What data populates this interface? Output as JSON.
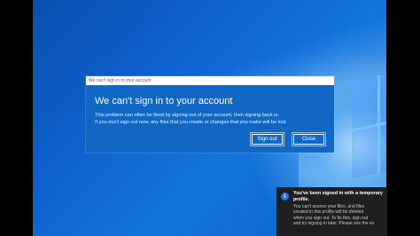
{
  "dialog": {
    "titlebar": "We can't sign in to your account",
    "heading": "We can't sign in to your account",
    "body_lines": [
      "This problem can often be fixed by signing out of your account, then signing back in.",
      "If you don't sign out now, any files that you create or changes that you make will be lost."
    ],
    "buttons": {
      "sign_out": "Sign out",
      "close": "Close"
    }
  },
  "toast": {
    "icon": "info-icon",
    "icon_glyph": "i",
    "title_lines": [
      "You've been signed in with a temporary",
      "profile."
    ],
    "body_lines": [
      "You can't access your files, and files",
      "created in this profile will be deleted",
      "when you sign out. To fix this, sign out",
      "and try signing in later. Please see the ev"
    ]
  },
  "colors": {
    "dialog_background": "#1068c4",
    "toast_background": "#1f1f1f",
    "info_icon": "#1a73e8",
    "desktop_background": "#0e63cf"
  }
}
